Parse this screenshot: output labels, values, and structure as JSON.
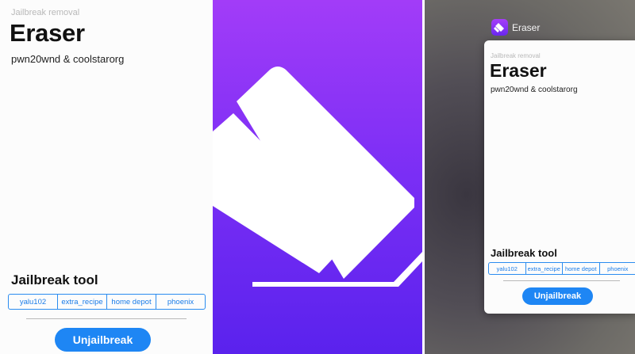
{
  "app": {
    "category": "Jailbreak removal",
    "name": "Eraser",
    "authors": "pwn20wnd & coolstarorg"
  },
  "tool_section": {
    "heading": "Jailbreak tool",
    "options": [
      "yalu102",
      "extra_recipe",
      "home depot",
      "phoenix"
    ]
  },
  "action": {
    "label": "Unjailbreak"
  },
  "switcher": {
    "app_label": "Eraser"
  },
  "colors": {
    "accent": "#1e86f4",
    "icon_gradient_top": "#a23cf8",
    "icon_gradient_bottom": "#5a22ed"
  },
  "icons": {
    "app_icon": "eraser-icon"
  }
}
